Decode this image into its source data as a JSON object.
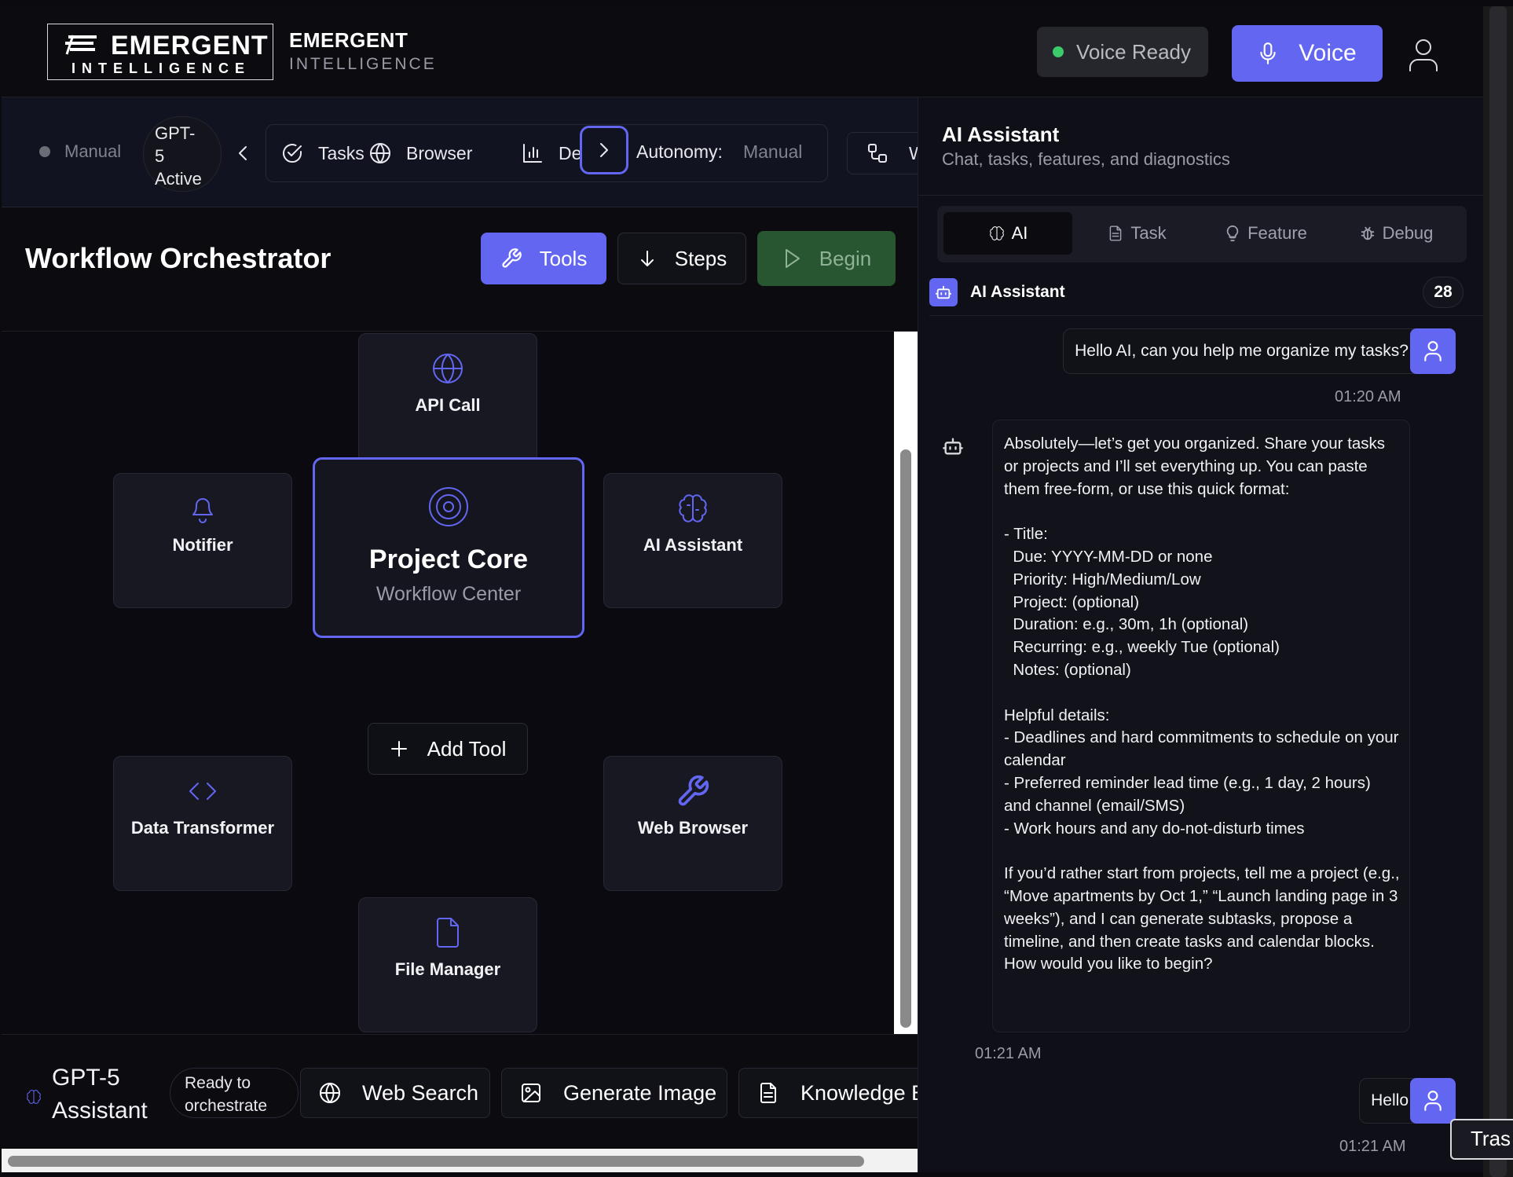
{
  "brand": {
    "logo_word": "EMERGENT",
    "logo_sub": "INTELLIGENCE",
    "title": "EMERGENT",
    "subtitle": "INTELLIGENCE"
  },
  "top": {
    "voice_status": "Voice Ready",
    "voice_button": "Voice"
  },
  "toolbar": {
    "mode_status": "Manual",
    "model_pill": "GPT-\n5\nActive",
    "nav": [
      "Tasks",
      "Browser",
      "De"
    ],
    "autonomy_label": "Autonomy:",
    "autonomy_value": "Manual",
    "w_button": "W"
  },
  "workflow": {
    "title": "Workflow Orchestrator",
    "tools_button": "Tools",
    "steps_button": "Steps",
    "begin_button": "Begin"
  },
  "canvas": {
    "core_title": "Project Core",
    "core_subtitle": "Workflow Center",
    "nodes": {
      "api": "API Call",
      "notifier": "Notifier",
      "ai": "AI Assistant",
      "transformer": "Data Transformer",
      "browser": "Web Browser",
      "files": "File Manager"
    },
    "add_tool": "Add Tool"
  },
  "bottom": {
    "assistant": "GPT-5\nAssistant",
    "status": "Ready to\norchestrate",
    "actions": [
      "Web Search",
      "Generate Image",
      "Knowledge B"
    ]
  },
  "panel": {
    "title": "AI Assistant",
    "subtitle": "Chat, tasks, features, and diagnostics",
    "tabs": [
      "AI",
      "Task",
      "Feature",
      "Debug"
    ],
    "conversation_name": "AI Assistant",
    "message_count": "28",
    "messages": [
      {
        "role": "user",
        "text": "Hello AI, can you help me organize my tasks?",
        "time": "01:20 AM"
      },
      {
        "role": "assistant",
        "text": "Absolutely—let’s get you organized. Share your tasks or projects and I’ll set everything up. You can paste them free-form, or use this quick format:\n\n- Title:\n  Due: YYYY-MM-DD or none\n  Priority: High/Medium/Low\n  Project: (optional)\n  Duration: e.g., 30m, 1h (optional)\n  Recurring: e.g., weekly Tue (optional)\n  Notes: (optional)\n\nHelpful details:\n- Deadlines and hard commitments to schedule on your calendar\n- Preferred reminder lead time (e.g., 1 day, 2 hours) and channel (email/SMS)\n- Work hours and any do-not-disturb times\n\nIf you’d rather start from projects, tell me a project (e.g., “Move apartments by Oct 1,” “Launch landing page in 3 weeks”), and I can generate subtasks, propose a timeline, and then create tasks and calendar blocks. How would you like to begin?",
        "time": "01:21 AM"
      },
      {
        "role": "user",
        "text": "Hello",
        "time": "01:21 AM"
      }
    ]
  },
  "tooltip": "Tras",
  "colors": {
    "accent": "#6366f1",
    "success": "#3ccb6b",
    "begin_bg": "#275630"
  }
}
